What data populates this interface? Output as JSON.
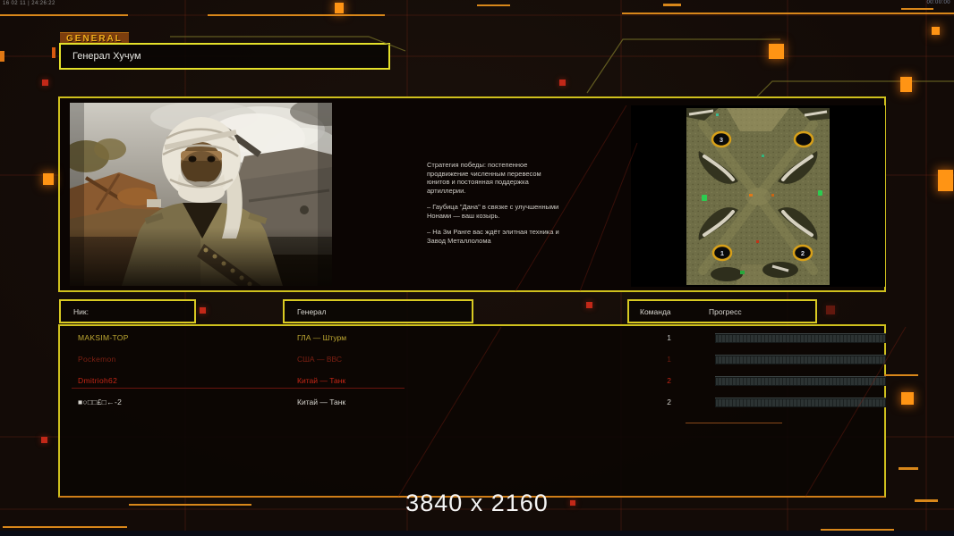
{
  "system": {
    "top_left": "16 02 11 | 24:26:22",
    "top_right": "00:00:00"
  },
  "header": {
    "tab_label": "GENERAL",
    "general_name": "Генерал Хучум"
  },
  "briefing": {
    "paragraphs": [
      "Стратегия победы: постепенное продвижение численным перевесом юнитов и постоянная поддержка артиллерии.",
      "– Гаубица \"Дана\" в связке с улучшенными Нонами — ваш козырь.",
      "– На 3м Ранге вас ждёт элитная техника и Завод Металлолома"
    ]
  },
  "minimap": {
    "markers": [
      {
        "label": "3"
      },
      {
        "label": ""
      },
      {
        "label": "1"
      },
      {
        "label": "2"
      }
    ]
  },
  "table": {
    "headers": {
      "nick": "Ник:",
      "general": "Генерал",
      "team": "Команда",
      "progress": "Прогресс"
    },
    "rows": [
      {
        "nick": "MAKSIM-TOP",
        "general": "ГЛА — Штурм",
        "team": "1",
        "nick_color": "#bfa832",
        "team_color": "#c6c6c2"
      },
      {
        "nick": "Pockemon",
        "general": "США — ВВС",
        "team": "1",
        "nick_color": "#7c2013",
        "team_color": "#6d1c10"
      },
      {
        "nick": "Dmitrioh62",
        "general": "Китай — Танк",
        "team": "2",
        "nick_color": "#c62616",
        "team_color": "#c62616"
      },
      {
        "nick": "■○□□£□←-2",
        "general": "Китай — Танк",
        "team": "2",
        "nick_color": "#d6d4ce",
        "team_color": "#d6d4ce"
      }
    ]
  },
  "footer": {
    "resolution": "3840 x 2160"
  },
  "colors": {
    "accent_orange": "#ff9414",
    "panel_border": "#cfc01d",
    "glow_red": "#c22818"
  }
}
